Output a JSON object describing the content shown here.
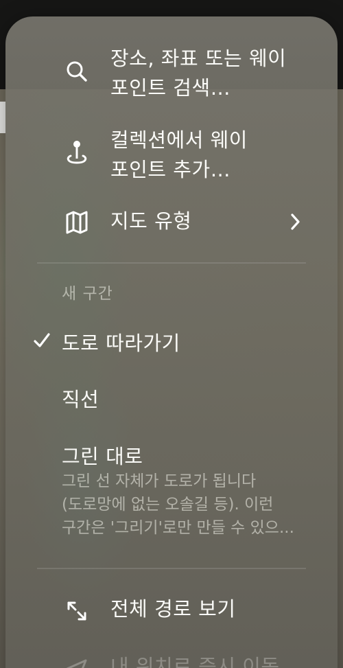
{
  "menu": {
    "search": {
      "label": "장소, 좌표 또는 웨이\n포인트 검색…",
      "icon": "search-icon"
    },
    "add_waypoint": {
      "label": "컬렉션에서 웨이\n포인트 추가…",
      "icon": "map-pin-icon"
    },
    "map_type": {
      "label": "지도 유형",
      "icon": "map-icon",
      "chevron": "›"
    },
    "new_segment": {
      "header": "새 구간",
      "options": [
        {
          "label": "도로 따라가기",
          "checked": true
        },
        {
          "label": "직선",
          "checked": false
        },
        {
          "label": "그린 대로",
          "checked": false
        }
      ],
      "drawn_description": [
        "그린 선 자체가 도로가 됩니다",
        "(도로망에 없는 오솔길 등). 이런",
        "구간은 '그리기'로만 만들 수 있으..."
      ]
    },
    "show_full_route": {
      "label": "전체 경로 보기",
      "icon": "expand-arrows-icon"
    },
    "go_to_location": {
      "label": "내 위치로 즉시 이동",
      "icon": "location-arrow-icon"
    }
  },
  "colors": {
    "panel": "#767469",
    "text": "#fbfbf8",
    "muted": "#b9b7ad"
  }
}
